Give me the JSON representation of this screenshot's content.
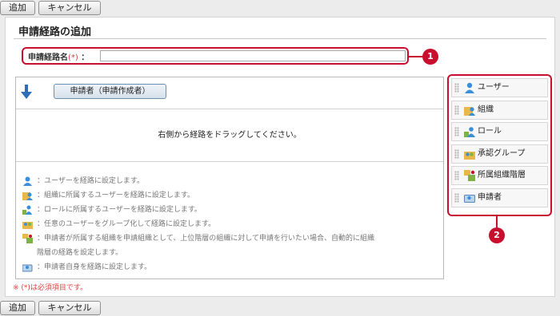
{
  "toolbar": {
    "add_label": "追加",
    "cancel_label": "キャンセル"
  },
  "page": {
    "title": "申請経路の追加"
  },
  "name_field": {
    "label": "申請経路名",
    "required_mark": "(*)",
    "colon": "：",
    "value": ""
  },
  "route": {
    "applicant_chip": "申請者（申請作成者）",
    "drop_message": "右側から経路をドラッグしてください。"
  },
  "legend": [
    {
      "icon": "user-icon",
      "text": "：ユーザーを経路に設定します。"
    },
    {
      "icon": "organization-icon",
      "text": "：組織に所属するユーザーを経路に設定します。"
    },
    {
      "icon": "role-icon",
      "text": "：ロールに所属するユーザーを経路に設定します。"
    },
    {
      "icon": "approval-group-icon",
      "text": "：任意のユーザーをグループ化して経路に設定します。"
    },
    {
      "icon": "org-hierarchy-icon",
      "text": "：申請者が所属する組織を申請組織として、上位階層の組織に対して申請を行いたい場合、自動的に組織"
    },
    {
      "icon": "",
      "text": "階層の経路を設定します。"
    },
    {
      "icon": "applicant-icon",
      "text": "：申請者自身を経路に設定します。"
    }
  ],
  "required_note": "※ (*)は必須項目です。",
  "palette": [
    {
      "icon": "user-icon",
      "label": "ユーザー"
    },
    {
      "icon": "organization-icon",
      "label": "組織"
    },
    {
      "icon": "role-icon",
      "label": "ロール"
    },
    {
      "icon": "approval-group-icon",
      "label": "承認グループ"
    },
    {
      "icon": "org-hierarchy-icon",
      "label": "所属組織階層"
    },
    {
      "icon": "applicant-icon",
      "label": "申請者"
    }
  ],
  "callouts": {
    "first": "1",
    "second": "2"
  },
  "colors": {
    "accent_red": "#c8102e",
    "required_red": "#e04040"
  }
}
